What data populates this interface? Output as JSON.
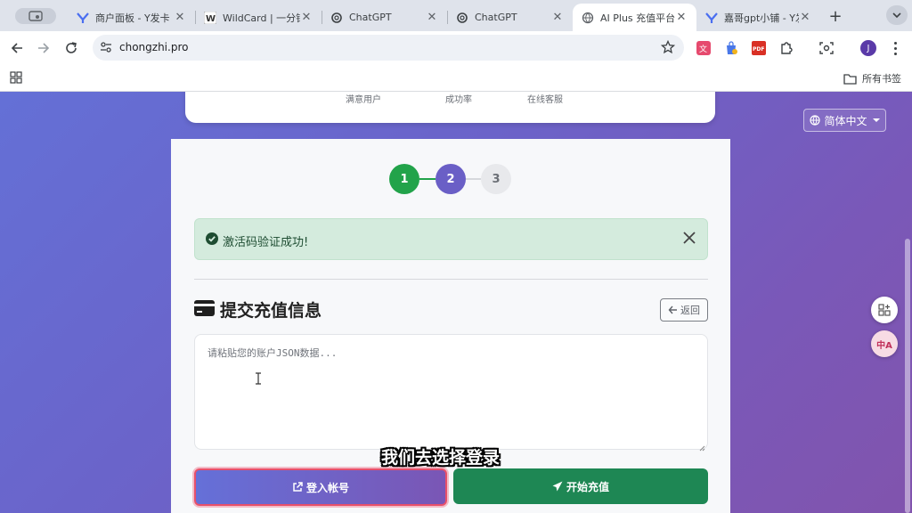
{
  "browser": {
    "tabs": [
      {
        "title": "商户面板 - Y发卡",
        "icon": "y-logo-icon"
      },
      {
        "title": "WildCard | 一分钟",
        "icon": "wildcard-logo-icon"
      },
      {
        "title": "ChatGPT",
        "icon": "openai-icon"
      },
      {
        "title": "ChatGPT",
        "icon": "openai-icon"
      },
      {
        "title": "AI Plus 充值平台",
        "icon": "globe-icon"
      },
      {
        "title": "嘉哥gpt小铺 - Y发",
        "icon": "y-logo-icon"
      }
    ],
    "active_tab": 4,
    "url": "chongzhi.pro",
    "profile_initial": "J",
    "extensions": [
      "translate-extension-icon",
      "bag-extension-icon",
      "pdf-extension-icon",
      "puzzle-icon",
      "screenshot-icon"
    ],
    "pdf_label": "PDF",
    "bookmarks_label": "所有书签"
  },
  "page": {
    "stats": [
      "满意用户",
      "成功率",
      "在线客服"
    ],
    "steps": [
      "1",
      "2",
      "3"
    ],
    "alert": {
      "text": "激活码验证成功!"
    },
    "section_title": "提交充值信息",
    "back_label": "返回",
    "json_placeholder": "请粘贴您的账户JSON数据...",
    "login_button": "登入帐号",
    "recharge_button": "开始充值",
    "language": "简体中文",
    "translate_badge": "中A",
    "colors": {
      "success": "#22a34a",
      "active_step": "#6a5fc6",
      "recharge": "#1e8754",
      "highlight": "#e8506a"
    }
  },
  "caption": "我们去选择登录"
}
